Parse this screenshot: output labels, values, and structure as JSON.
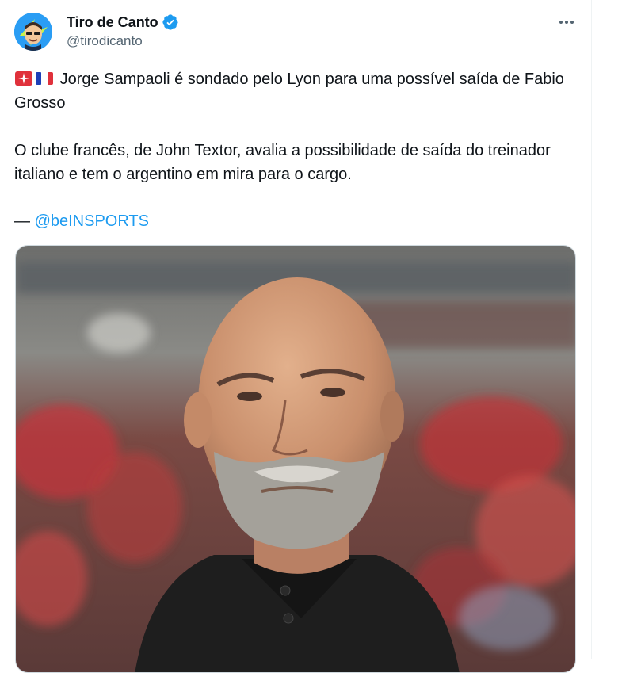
{
  "author": {
    "display_name": "Tiro de Canto",
    "handle": "@tirodicanto",
    "avatar_icon": "avatar-cartoon-icon",
    "verified_icon": "verified-badge-icon"
  },
  "more_icon": "more-options-icon",
  "tweet": {
    "line1": "Jorge Sampaoli é sondado pelo Lyon para uma possível saída de Fabio Grosso",
    "line2": "O clube francês, de John Textor, avalia a possibilidade de saída do treinador italiano e tem o argentino em mira para o cargo.",
    "line3_prefix": "— ",
    "mention": "@beINSPORTS",
    "emojis": [
      "rotating-light-icon",
      "france-flag-icon"
    ]
  },
  "media": {
    "description_icon": "photo-bald-man-black-shirt-stadium"
  },
  "colors": {
    "accent": "#1d9bf0",
    "text": "#0f1419",
    "secondary": "#536471"
  }
}
